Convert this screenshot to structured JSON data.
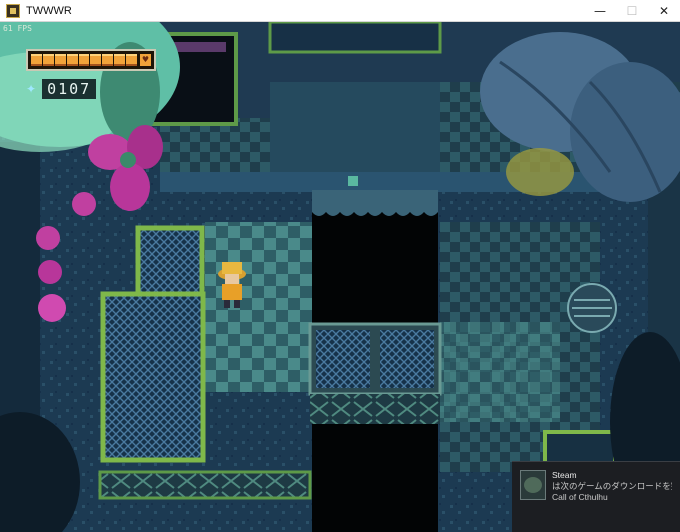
{
  "window": {
    "title": "TWWWR",
    "minimize": "—",
    "maximize": "☐",
    "close": "✕"
  },
  "hud": {
    "fps": "61 FPS",
    "health_fraction": 1.0,
    "gem_count": "0107",
    "spark_glyph": "✦",
    "heart_glyph": "♥"
  },
  "notification": {
    "app": "Steam",
    "message": "は次のゲームのダウンロードを完了しま...",
    "game": "Call of Cthulhu"
  },
  "colors": {
    "health": "#f0a23a",
    "floor_teal": "#3f7d7d",
    "grass_green": "#7fb84a",
    "flower_pink": "#c040a0"
  }
}
